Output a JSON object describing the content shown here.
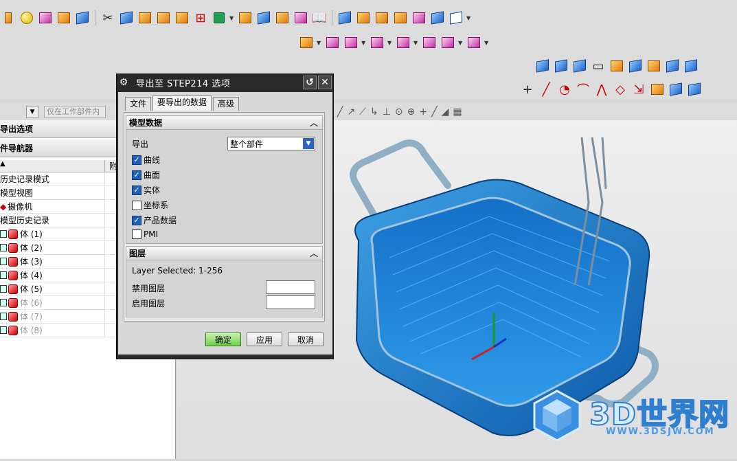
{
  "filter": {
    "placeholder": "仅在工作部件内"
  },
  "left_panel": {
    "export_options_title": "导出选项",
    "navigator_title": "件导航器",
    "column_attach": "附",
    "tree": [
      {
        "label": "历史记录模式",
        "dim": false
      },
      {
        "label": "模型视图",
        "dim": false
      },
      {
        "label": "摄像机",
        "dim": false
      },
      {
        "label": "模型历史记录",
        "dim": false
      },
      {
        "label": "体 (1)",
        "dim": false
      },
      {
        "label": "体 (2)",
        "dim": false
      },
      {
        "label": "体 (3)",
        "dim": false
      },
      {
        "label": "体 (4)",
        "dim": false
      },
      {
        "label": "体 (5)",
        "dim": false
      },
      {
        "label": "体 (6)",
        "dim": true
      },
      {
        "label": "体 (7)",
        "dim": true
      },
      {
        "label": "体 (8)",
        "dim": true
      }
    ]
  },
  "dialog": {
    "title": "导出至 STEP214 选项",
    "tabs": [
      "文件",
      "要导出的数据",
      "高级"
    ],
    "active_tab": 1,
    "model_section": {
      "title": "模型数据",
      "export_label": "导出",
      "export_value": "整个部件",
      "options": [
        {
          "label": "曲线",
          "checked": true
        },
        {
          "label": "曲面",
          "checked": true
        },
        {
          "label": "实体",
          "checked": true
        },
        {
          "label": "坐标系",
          "checked": false
        },
        {
          "label": "产品数据",
          "checked": true
        },
        {
          "label": "PMI",
          "checked": false
        }
      ]
    },
    "layer_section": {
      "title": "图层",
      "layer_selected": "Layer Selected: 1-256",
      "disable_label": "禁用图层",
      "enable_label": "启用图层",
      "disable_value": "",
      "enable_value": ""
    },
    "buttons": {
      "ok": "确定",
      "apply": "应用",
      "cancel": "取消"
    }
  },
  "watermark": {
    "text": "3D世界网",
    "url": "WWW.3DSJW.COM"
  },
  "colors": {
    "accent": "#1e5fb8",
    "ok_button": "#6fcf4e",
    "model_blue": "#2a8fd8"
  }
}
